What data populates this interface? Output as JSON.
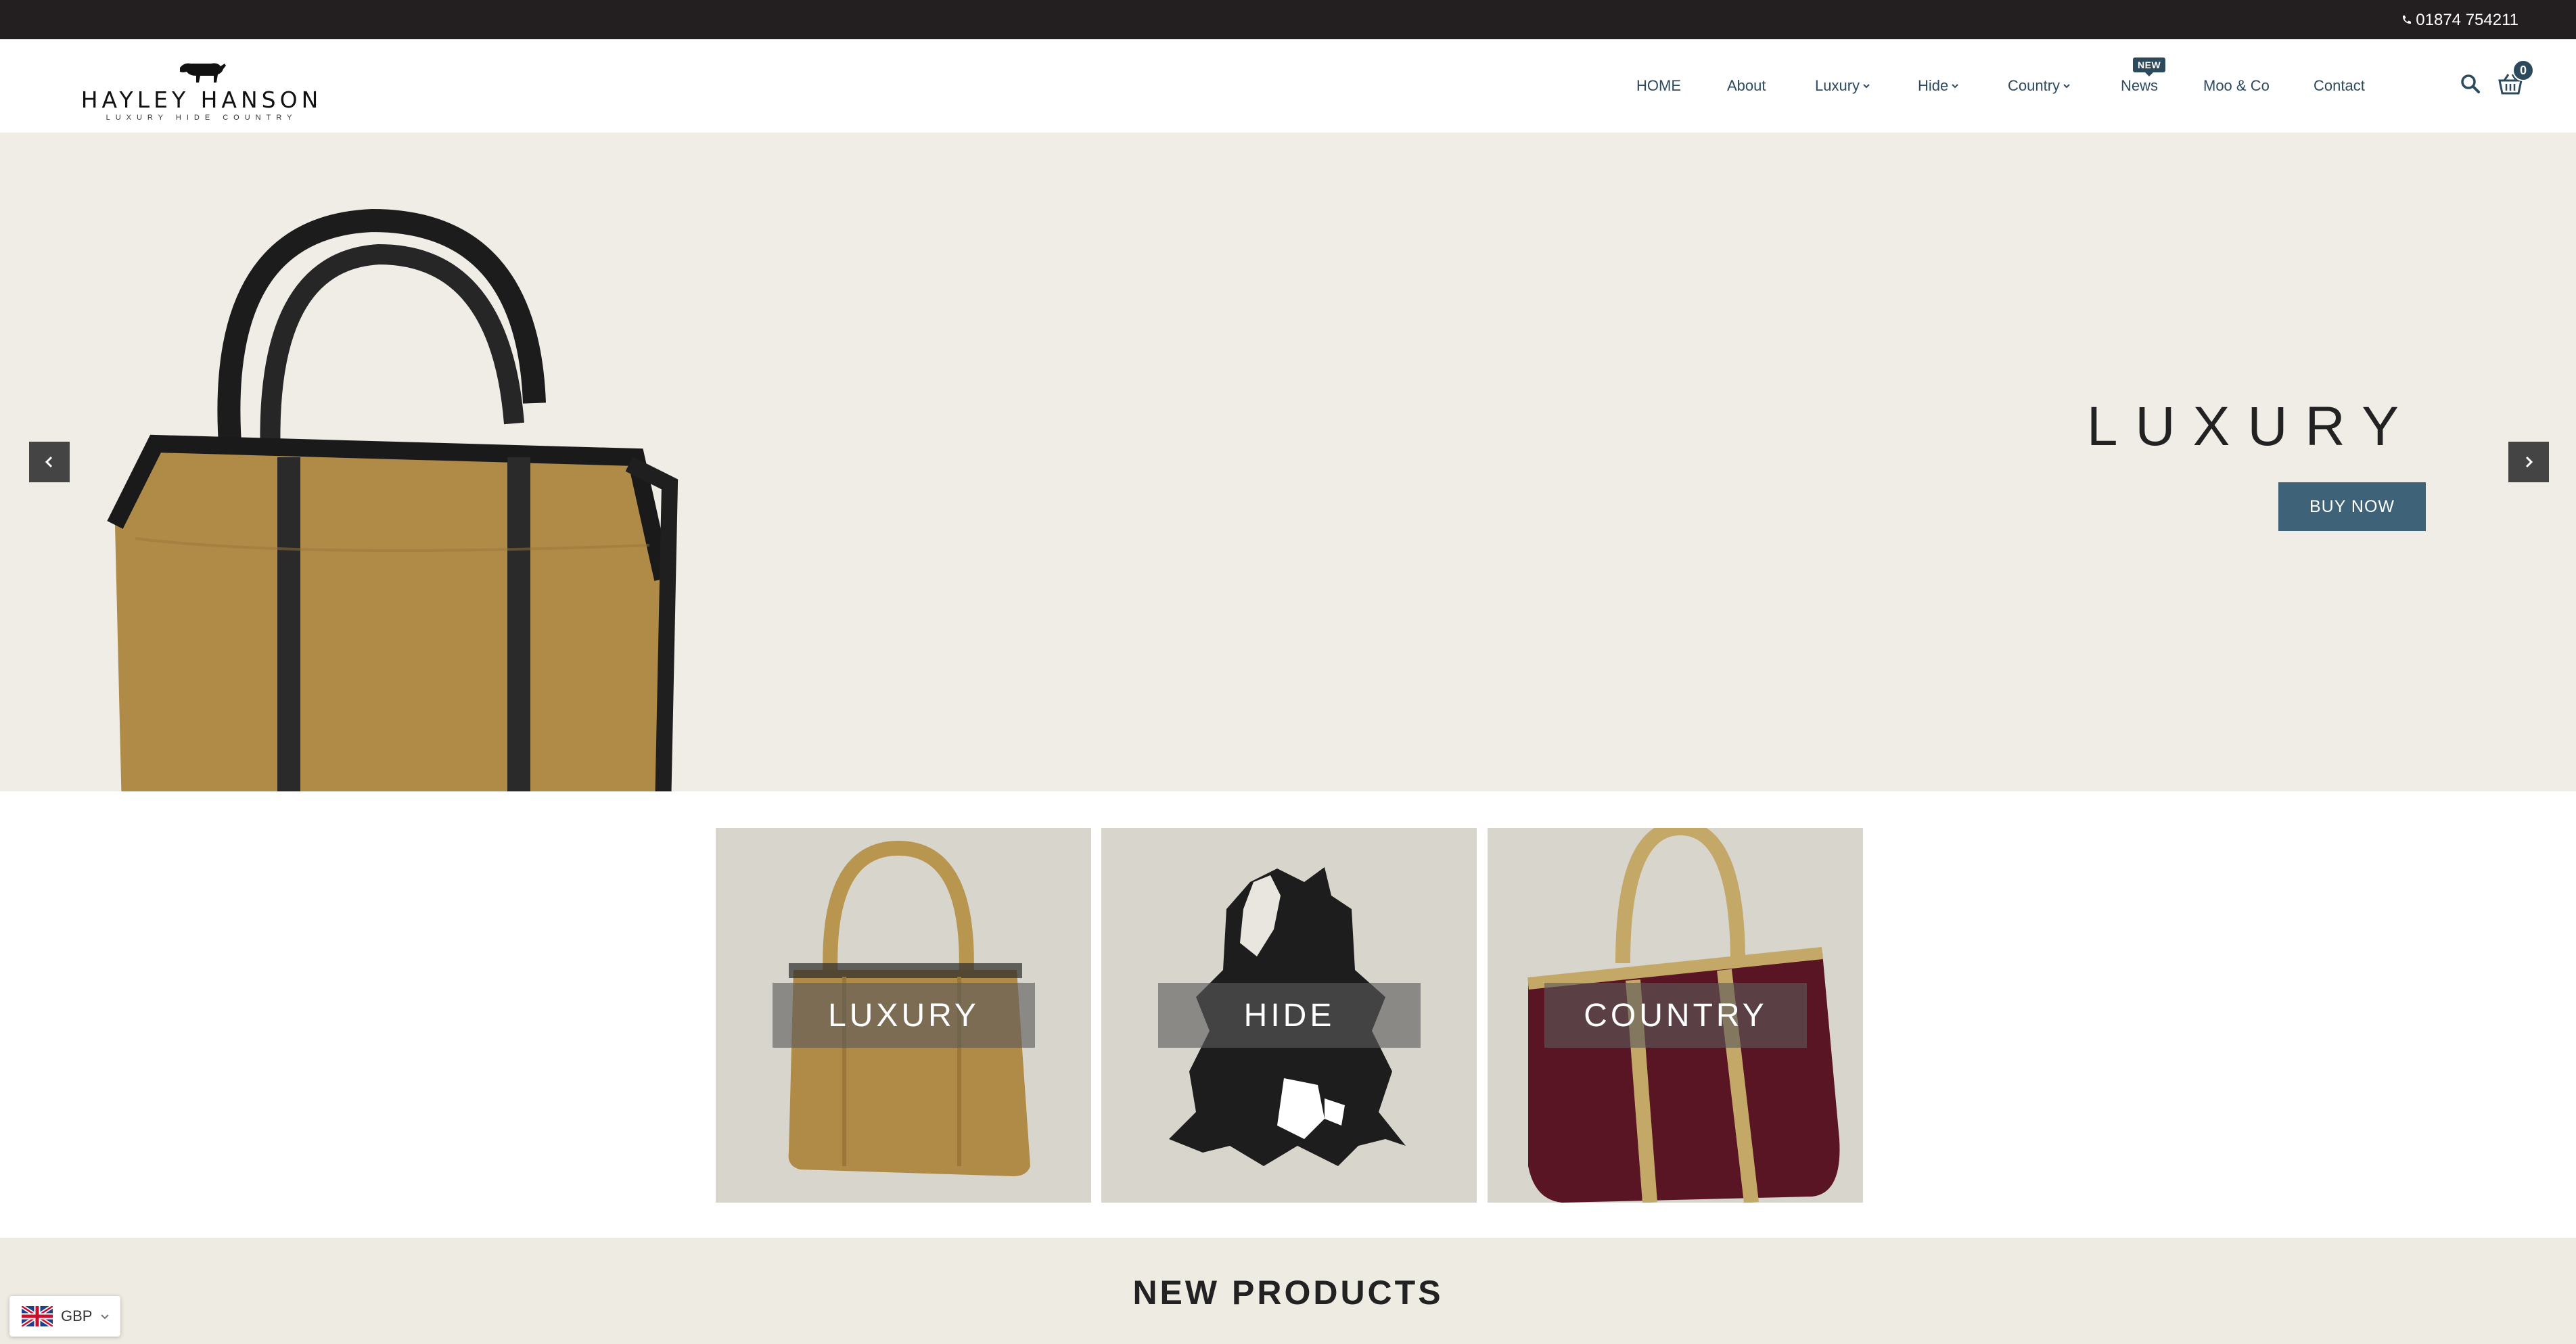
{
  "topbar": {
    "phone": "01874 754211"
  },
  "brand": {
    "name": "HAYLEY HANSON",
    "tagline": "LUXURY  HIDE  COUNTRY"
  },
  "nav": {
    "items": [
      {
        "label": "HOME",
        "dropdown": false
      },
      {
        "label": "About",
        "dropdown": false
      },
      {
        "label": "Luxury",
        "dropdown": true
      },
      {
        "label": "Hide",
        "dropdown": true
      },
      {
        "label": "Country",
        "dropdown": true
      },
      {
        "label": "News",
        "dropdown": false,
        "badge": "NEW"
      },
      {
        "label": "Moo & Co",
        "dropdown": false
      },
      {
        "label": "Contact",
        "dropdown": false
      }
    ],
    "cart_count": "0"
  },
  "hero": {
    "title": "LUXURY",
    "button": "BUY NOW"
  },
  "categories": [
    {
      "label": "LUXURY"
    },
    {
      "label": "HIDE"
    },
    {
      "label": "COUNTRY"
    }
  ],
  "new_products": {
    "heading": "NEW PRODUCTS"
  },
  "currency": {
    "code": "GBP"
  },
  "colors": {
    "accent": "#3e6378",
    "topbar": "#231f20",
    "hero_bg": "#f0ede6",
    "nav_text": "#2c4a5e"
  },
  "icons": [
    "phone-icon",
    "search-icon",
    "cart-icon",
    "chevron-left-icon",
    "chevron-right-icon",
    "chevron-down-icon",
    "uk-flag-icon"
  ]
}
